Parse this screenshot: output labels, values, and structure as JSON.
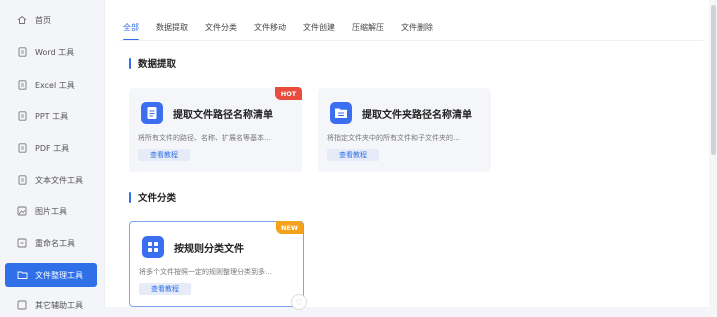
{
  "sidebar": {
    "items": [
      {
        "label": "首页",
        "icon": "home-icon"
      },
      {
        "label": "Word 工具",
        "icon": "file-icon"
      },
      {
        "label": "Excel 工具",
        "icon": "file-icon"
      },
      {
        "label": "PPT 工具",
        "icon": "file-icon"
      },
      {
        "label": "PDF 工具",
        "icon": "file-icon"
      },
      {
        "label": "文本文件工具",
        "icon": "file-icon"
      },
      {
        "label": "图片工具",
        "icon": "image-icon"
      },
      {
        "label": "重命名工具",
        "icon": "rename-icon"
      },
      {
        "label": "文件整理工具",
        "icon": "folder-icon"
      },
      {
        "label": "其它辅助工具",
        "icon": "tool-icon"
      }
    ],
    "active_index": 8
  },
  "tabs": [
    "全部",
    "数据提取",
    "文件分类",
    "文件移动",
    "文件创建",
    "压缩解压",
    "文件删除"
  ],
  "sections": [
    {
      "title": "数据提取",
      "cards": [
        {
          "title": "提取文件路径名称清单",
          "desc": "将所有文件的路径、名称、扩展名等基本…",
          "button": "查看教程",
          "badge": "HOT",
          "icon": "document-icon"
        },
        {
          "title": "提取文件夹路径名称清单",
          "desc": "将指定文件夹中的所有文件和子文件夹的…",
          "button": "查看教程",
          "badge": "",
          "icon": "folder-list-icon"
        }
      ]
    },
    {
      "title": "文件分类",
      "cards": [
        {
          "title": "按规则分类文件",
          "desc": "将多个文件按照一定的规则整理分类到多…",
          "button": "查看教程",
          "badge": "NEW",
          "icon": "grid-icon"
        }
      ]
    }
  ],
  "colors": {
    "accent": "#2f6fe8",
    "hot": "#e94b3c",
    "new": "#f4a11c"
  }
}
